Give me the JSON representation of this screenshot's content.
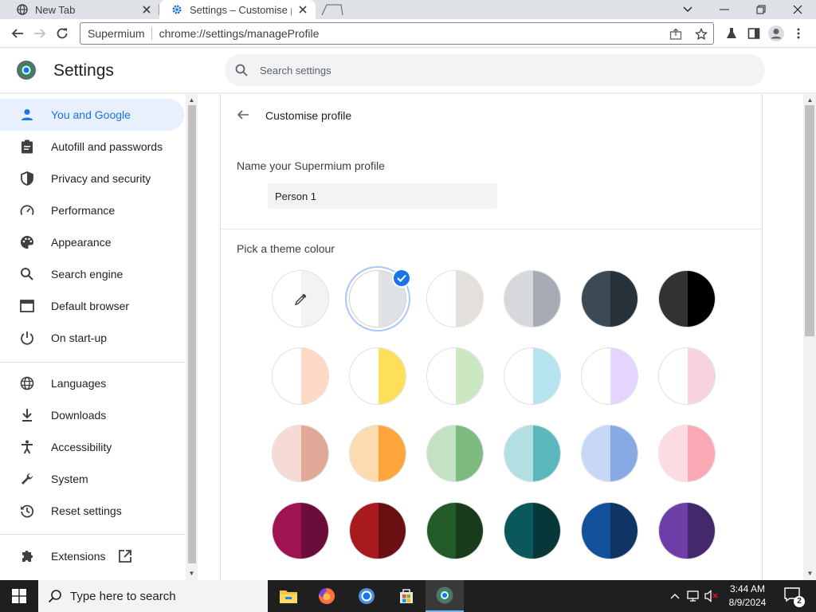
{
  "browser": {
    "tabs": [
      {
        "title": "New Tab",
        "icon": "globe-icon"
      },
      {
        "title": "Settings – Customise profile",
        "icon": "gear-icon",
        "active": true
      }
    ],
    "omnibox": {
      "origin": "Supermium",
      "url": "chrome://settings/manageProfile"
    }
  },
  "settings": {
    "title": "Settings",
    "search_placeholder": "Search settings"
  },
  "sidebar": {
    "items": [
      {
        "label": "You and Google",
        "icon": "person-icon",
        "active": true
      },
      {
        "label": "Autofill and passwords",
        "icon": "clipboard-icon"
      },
      {
        "label": "Privacy and security",
        "icon": "shield-icon"
      },
      {
        "label": "Performance",
        "icon": "speedometer-icon"
      },
      {
        "label": "Appearance",
        "icon": "palette-icon"
      },
      {
        "label": "Search engine",
        "icon": "search-icon"
      },
      {
        "label": "Default browser",
        "icon": "browser-window-icon"
      },
      {
        "label": "On start-up",
        "icon": "power-icon"
      },
      {
        "label": "Languages",
        "icon": "globe-icon"
      },
      {
        "label": "Downloads",
        "icon": "download-icon"
      },
      {
        "label": "Accessibility",
        "icon": "accessibility-icon"
      },
      {
        "label": "System",
        "icon": "wrench-icon"
      },
      {
        "label": "Reset settings",
        "icon": "history-icon"
      },
      {
        "label": "Extensions",
        "icon": "puzzle-icon"
      }
    ]
  },
  "profile": {
    "subpage_title": "Customise profile",
    "name_label": "Name your Supermium profile",
    "name_value": "Person 1",
    "theme_label": "Pick a theme colour",
    "colors": [
      {
        "left": "#ffffff",
        "right": "#f1f3f4",
        "custom": true
      },
      {
        "left": "#ffffff",
        "right": "#dee1e6",
        "selected": true
      },
      {
        "left": "#ffffff",
        "right": "#e3e0dc"
      },
      {
        "left": "#d7d8dc",
        "right": "#a7abb5"
      },
      {
        "left": "#3c4a56",
        "right": "#28323b"
      },
      {
        "left": "#323232",
        "right": "#000000"
      },
      {
        "left": "#ffffff",
        "right": "#fcdac5"
      },
      {
        "left": "#ffffff",
        "right": "#fedf59"
      },
      {
        "left": "#ffffff",
        "right": "#cbe8c2"
      },
      {
        "left": "#ffffff",
        "right": "#b5e4ef"
      },
      {
        "left": "#ffffff",
        "right": "#e3d5fb"
      },
      {
        "left": "#ffffff",
        "right": "#f7d3e1"
      },
      {
        "left": "#f5dbd4",
        "right": "#e0a897"
      },
      {
        "left": "#fddbb1",
        "right": "#fea53b"
      },
      {
        "left": "#c3e2c4",
        "right": "#7cba7f"
      },
      {
        "left": "#b2e0e2",
        "right": "#5ab8bd"
      },
      {
        "left": "#c7d8f7",
        "right": "#87a9e4"
      },
      {
        "left": "#fcdbe1",
        "right": "#fba7b4"
      },
      {
        "left": "#a01353",
        "right": "#6b0d3b"
      },
      {
        "left": "#a81a1c",
        "right": "#6a1012"
      },
      {
        "left": "#235b28",
        "right": "#1a3a1c"
      },
      {
        "left": "#0a585c",
        "right": "#06383a"
      },
      {
        "left": "#13519a",
        "right": "#0e3563"
      },
      {
        "left": "#6d3ea7",
        "right": "#43286b"
      }
    ]
  },
  "taskbar": {
    "search_placeholder": "Type here to search",
    "time": "3:44 AM",
    "date": "8/9/2024",
    "notification_count": "2"
  }
}
